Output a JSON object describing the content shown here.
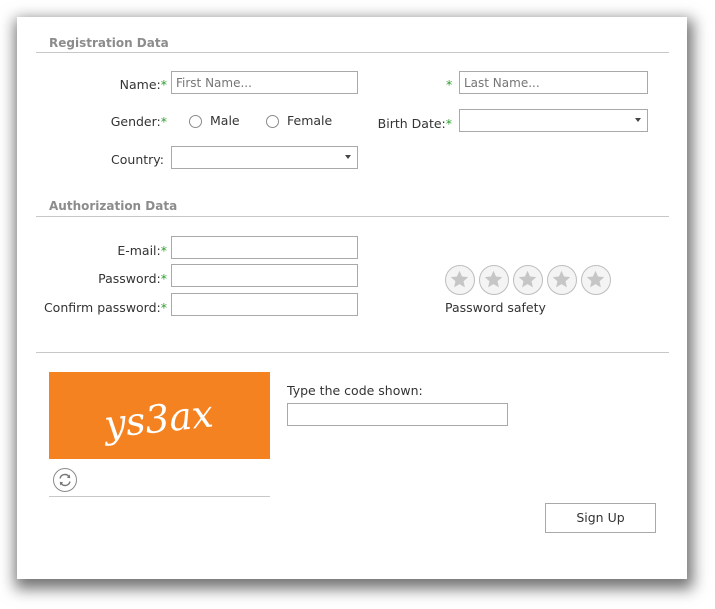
{
  "registration": {
    "section_title": "Registration Data",
    "name_label": "Name:",
    "required_mark": "*",
    "first_name_placeholder": "First Name...",
    "last_name_placeholder": "Last Name...",
    "gender_label": "Gender:",
    "gender_options": [
      "Male",
      "Female"
    ],
    "birth_date_label": "Birth Date:",
    "birth_date_value": "",
    "country_label": "Country:",
    "country_value": ""
  },
  "authorization": {
    "section_title": "Authorization Data",
    "email_label": "E-mail:",
    "password_label": "Password:",
    "confirm_password_label": "Confirm password:",
    "password_safety_label": "Password safety",
    "password_safety_stars_total": 5,
    "password_safety_stars_filled": 0
  },
  "captcha": {
    "code_text": "ys3ax",
    "prompt_label": "Type the code shown:",
    "input_value": "",
    "background_color": "#f58220",
    "refresh_icon": "refresh-icon"
  },
  "actions": {
    "sign_up_label": "Sign Up"
  }
}
